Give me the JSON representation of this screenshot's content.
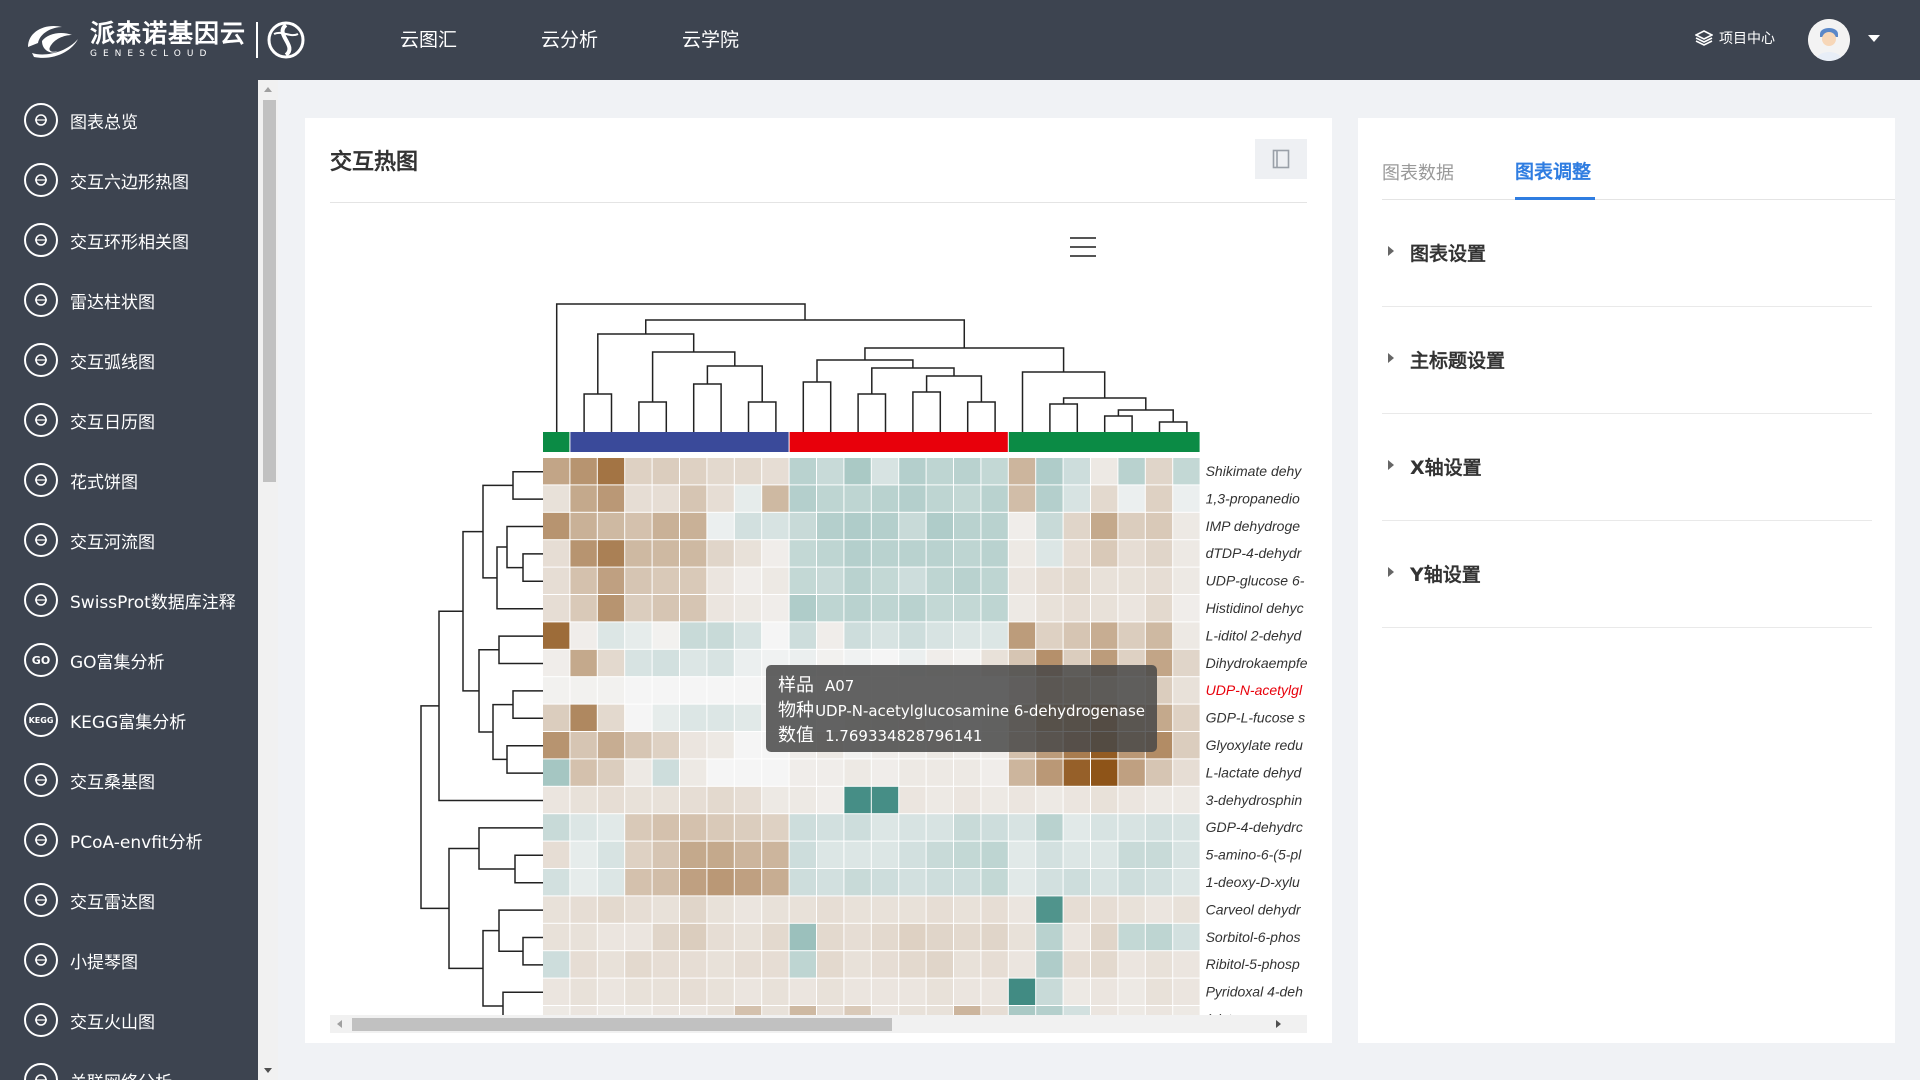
{
  "brand": {
    "name_cn": "派森诺基因云",
    "name_en": "GENESCLOUD"
  },
  "nav": [
    "云图汇",
    "云分析",
    "云学院"
  ],
  "header": {
    "project_center": "项目中心"
  },
  "sidebar": {
    "items": [
      {
        "label": "图表总览",
        "icon": "table-icon"
      },
      {
        "label": "交互六边形热图",
        "icon": "hexagon-icon"
      },
      {
        "label": "交互环形相关图",
        "icon": "ring-icon"
      },
      {
        "label": "雷达柱状图",
        "icon": "radar-bar-icon"
      },
      {
        "label": "交互弧线图",
        "icon": "arc-icon"
      },
      {
        "label": "交互日历图",
        "icon": "calendar-icon"
      },
      {
        "label": "花式饼图",
        "icon": "flower-icon"
      },
      {
        "label": "交互河流图",
        "icon": "river-icon"
      },
      {
        "label": "SwissProt数据库注释",
        "icon": "mountain-icon"
      },
      {
        "label": "GO富集分析",
        "icon": "go-icon",
        "badge": "GO"
      },
      {
        "label": "KEGG富集分析",
        "icon": "kegg-icon",
        "badge": "KEGG"
      },
      {
        "label": "交互桑基图",
        "icon": "sankey-icon"
      },
      {
        "label": "PCoA-envfit分析",
        "icon": "pcoa-icon"
      },
      {
        "label": "交互雷达图",
        "icon": "radar-icon"
      },
      {
        "label": "小提琴图",
        "icon": "violin-icon"
      },
      {
        "label": "交互火山图",
        "icon": "volcano-icon"
      },
      {
        "label": "关联网络分析",
        "icon": "network-icon"
      }
    ]
  },
  "card": {
    "title": "交互热图"
  },
  "chart_data": {
    "type": "heatmap",
    "row_labels": [
      "Shikimate dehy",
      "1,3-propanedio",
      "IMP dehydroge",
      "dTDP-4-dehydr",
      "UDP-glucose 6-",
      "Histidinol dehyc",
      "L-iditol 2-dehyd",
      "Dihydrokaempfe",
      "UDP-N-acetylgl",
      "GDP-L-fucose s",
      "Glyoxylate redu",
      "L-lactate dehyd",
      "3-dehydrosphin",
      "GDP-4-dehydrc",
      "5-amino-6-(5-pl",
      "1-deoxy-D-xylu",
      "Carveol dehydr",
      "Sorbitol-6-phos",
      "Ribitol-5-phosp",
      "Pyridoxal 4-deh",
      "(+)-trans-carvec"
    ],
    "highlight_row": 8,
    "group_colors": [
      "#0b8b45",
      "#3a4a9a",
      "#e8000b",
      "#0b8b45"
    ],
    "group_sizes": [
      1,
      8,
      8,
      7
    ],
    "color_scale": [
      "#2d7f76",
      "#f5f5f5",
      "#8e5418"
    ],
    "values": [
      [
        2.0,
        2.4,
        3.2,
        0.9,
        1.0,
        0.9,
        0.7,
        0.7,
        0.6,
        -1.2,
        -0.9,
        -1.5,
        -0.6,
        -1.3,
        -1.1,
        -1.2,
        -1.0,
        1.6,
        -1.4,
        -0.8,
        0.3,
        -1.2,
        0.8,
        -1.0
      ],
      [
        0.5,
        1.9,
        2.3,
        0.6,
        0.6,
        1.2,
        0.6,
        -0.3,
        1.5,
        -1.3,
        -1.1,
        -1.1,
        -1.2,
        -1.3,
        -1.1,
        -1.0,
        -1.2,
        1.4,
        -1.3,
        -0.6,
        0.7,
        -0.2,
        0.9,
        -0.2
      ],
      [
        2.4,
        1.7,
        1.5,
        1.3,
        1.7,
        1.7,
        -0.2,
        -0.7,
        -0.6,
        -0.9,
        -1.3,
        -1.4,
        -1.3,
        -0.9,
        -1.4,
        -1.2,
        -1.2,
        0.2,
        -0.9,
        0.8,
        1.9,
        1.0,
        1.1,
        0.3
      ],
      [
        0.6,
        2.4,
        2.9,
        1.5,
        1.5,
        1.5,
        0.8,
        0.5,
        0.2,
        -1.0,
        -1.1,
        -1.3,
        -1.2,
        -1.2,
        -1.2,
        -1.1,
        -1.2,
        0.3,
        -0.5,
        0.6,
        1.1,
        0.6,
        0.8,
        0.3
      ],
      [
        0.6,
        1.3,
        2.1,
        1.2,
        1.1,
        1.1,
        0.4,
        0.2,
        0.3,
        -1.0,
        -0.9,
        -1.2,
        -1.0,
        -0.8,
        -1.1,
        -1.2,
        -1.1,
        0.4,
        0.6,
        0.7,
        0.5,
        0.5,
        0.6,
        0.3
      ],
      [
        0.6,
        1.1,
        2.4,
        1.0,
        1.2,
        1.2,
        0.4,
        0.3,
        0.2,
        -1.4,
        -1.1,
        -1.2,
        -1.1,
        -1.2,
        -1.0,
        -1.0,
        -1.1,
        0.3,
        0.5,
        0.6,
        0.5,
        0.4,
        0.7,
        0.2
      ],
      [
        3.4,
        0.2,
        -0.5,
        -0.3,
        0.1,
        -0.9,
        -0.9,
        -0.6,
        0.0,
        -0.8,
        0.2,
        -0.8,
        -0.6,
        -0.8,
        -0.6,
        -0.5,
        -0.5,
        2.2,
        0.9,
        1.2,
        1.8,
        1.0,
        1.5,
        0.3
      ],
      [
        0.2,
        1.9,
        0.7,
        -0.6,
        -0.7,
        -0.5,
        -0.6,
        -0.2,
        -0.1,
        -0.2,
        0.1,
        -0.1,
        0.0,
        -0.2,
        0.2,
        0.1,
        0.5,
        1.2,
        2.5,
        1.0,
        2.2,
        0.9,
        2.0,
        0.8
      ],
      [
        0.1,
        0.1,
        0.1,
        0.0,
        0.0,
        0.0,
        0.0,
        0.0,
        0.0,
        0.0,
        0.0,
        0.0,
        0.0,
        0.0,
        0.0,
        0.0,
        0.0,
        0.6,
        1.8,
        1.5,
        1.2,
        0.7,
        1.0,
        0.5
      ],
      [
        1.0,
        2.7,
        0.7,
        0.0,
        -0.3,
        -0.5,
        -0.5,
        -0.4,
        0.0,
        -0.2,
        0.0,
        0.2,
        0.2,
        0.3,
        0.1,
        0.0,
        0.2,
        1.3,
        2.8,
        2.9,
        3.5,
        2.0,
        1.9,
        0.9
      ],
      [
        2.4,
        1.2,
        1.8,
        1.2,
        0.9,
        0.4,
        0.3,
        0.0,
        0.0,
        0.2,
        0.3,
        0.1,
        0.2,
        0.2,
        0.3,
        0.2,
        0.2,
        1.3,
        2.2,
        3.0,
        3.8,
        2.3,
        2.6,
        1.0
      ],
      [
        -1.6,
        1.3,
        1.0,
        0.3,
        -0.8,
        0.3,
        0.0,
        0.0,
        0.0,
        0.2,
        0.2,
        0.3,
        0.2,
        0.3,
        0.3,
        0.3,
        0.2,
        1.6,
        2.3,
        3.7,
        4.2,
        2.1,
        1.2,
        0.6
      ],
      [
        0.4,
        0.5,
        0.6,
        0.5,
        0.5,
        0.6,
        0.7,
        0.6,
        0.3,
        0.3,
        0.2,
        -3.5,
        -3.5,
        0.4,
        0.3,
        0.4,
        0.3,
        0.4,
        0.3,
        0.4,
        0.5,
        0.4,
        0.3,
        0.3
      ],
      [
        -0.9,
        -0.5,
        -0.4,
        1.1,
        1.3,
        1.3,
        1.1,
        1.0,
        0.9,
        -0.8,
        -0.7,
        -0.8,
        -0.5,
        -0.6,
        -0.6,
        -0.9,
        -0.8,
        -0.6,
        -1.2,
        -0.4,
        -0.6,
        -0.6,
        -0.7,
        -0.6
      ],
      [
        0.6,
        -0.3,
        -0.6,
        0.9,
        1.2,
        1.9,
        1.9,
        1.6,
        1.6,
        -0.8,
        -0.5,
        -0.5,
        -0.5,
        -0.7,
        -0.9,
        -1.0,
        -1.1,
        -0.4,
        -0.7,
        -0.5,
        -0.5,
        -0.9,
        -0.9,
        -0.6
      ],
      [
        -0.7,
        -0.3,
        -0.5,
        1.3,
        1.4,
        2.1,
        2.3,
        2.1,
        1.8,
        -0.8,
        -0.7,
        -0.9,
        -0.8,
        -0.7,
        -0.8,
        -0.8,
        -1.0,
        -0.4,
        -0.7,
        -0.8,
        -0.6,
        -0.8,
        -0.7,
        -0.5
      ],
      [
        0.5,
        0.6,
        0.7,
        0.6,
        0.5,
        0.8,
        0.5,
        0.4,
        0.5,
        0.5,
        0.6,
        0.5,
        0.5,
        0.5,
        0.6,
        0.5,
        0.6,
        0.4,
        -3.3,
        0.6,
        0.6,
        0.5,
        0.4,
        0.5
      ],
      [
        0.5,
        0.5,
        0.4,
        0.4,
        0.8,
        1.0,
        0.6,
        0.5,
        0.7,
        -1.8,
        0.7,
        0.6,
        0.7,
        0.9,
        0.8,
        0.7,
        0.8,
        0.5,
        -1.2,
        0.4,
        0.8,
        -1.0,
        -1.1,
        -0.7
      ],
      [
        -0.8,
        0.6,
        0.5,
        0.7,
        0.6,
        0.6,
        0.5,
        0.6,
        0.6,
        -1.1,
        0.7,
        0.5,
        0.6,
        0.7,
        0.8,
        0.5,
        0.6,
        0.4,
        -1.4,
        0.6,
        0.7,
        0.4,
        0.5,
        0.4
      ],
      [
        0.4,
        0.5,
        0.4,
        0.5,
        0.5,
        0.6,
        0.5,
        0.4,
        0.5,
        0.4,
        0.5,
        0.4,
        0.4,
        0.4,
        0.5,
        0.4,
        0.4,
        -3.6,
        -0.9,
        0.3,
        0.4,
        0.3,
        0.5,
        0.4
      ],
      [
        0.3,
        0.4,
        0.3,
        0.3,
        0.4,
        0.4,
        0.5,
        1.3,
        0.5,
        1.5,
        0.6,
        1.1,
        0.4,
        0.5,
        0.5,
        1.6,
        0.6,
        -1.5,
        -1.3,
        -0.7,
        0.4,
        0.3,
        0.4,
        0.3
      ]
    ]
  },
  "tooltip": {
    "sample_key": "样品",
    "sample_val": "A07",
    "species_key": "物种",
    "species_val": "UDP-N-acetylglucosamine 6-dehydrogenase",
    "value_key": "数值",
    "value_val": "1.769334828796141"
  },
  "panel": {
    "tabs": [
      "图表数据",
      "图表调整"
    ],
    "active_tab": 1,
    "sections": [
      "图表设置",
      "主标题设置",
      "X轴设置",
      "Y轴设置"
    ]
  }
}
